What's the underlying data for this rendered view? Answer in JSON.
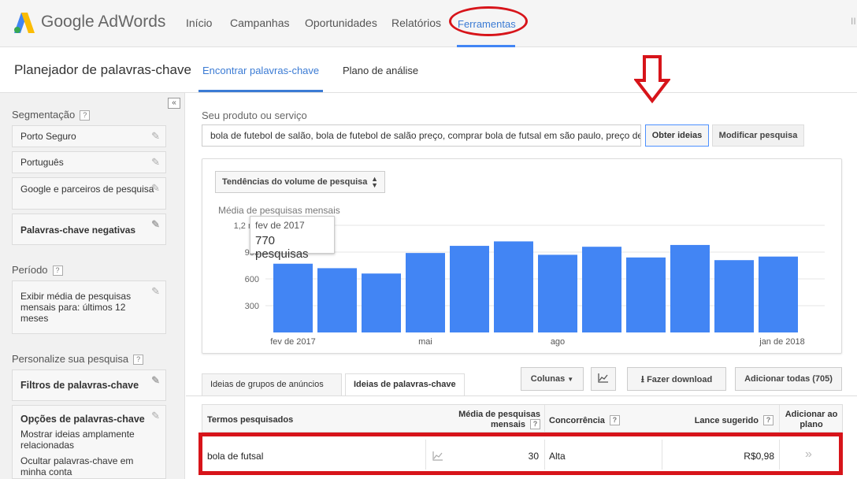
{
  "nav": {
    "logo_text": "Google AdWords",
    "items": [
      "Início",
      "Campanhas",
      "Oportunidades",
      "Relatórios",
      "Ferramentas"
    ],
    "active": "Ferramentas",
    "overflow": "II"
  },
  "subheader": {
    "title": "Planejador de palavras-chave",
    "tabs": [
      "Encontrar palavras-chave",
      "Plano de análise"
    ]
  },
  "sidebar": {
    "segmentation_title": "Segmentação",
    "help": "?",
    "segmentation_items": [
      "Porto Seguro",
      "Português",
      "Google e parceiros de pesquisa",
      "Palavras-chave negativas"
    ],
    "period_title": "Período",
    "period_item": "Exibir média de pesquisas mensais para: últimos 12 meses",
    "customize_title": "Personalize sua pesquisa",
    "filters": "Filtros de palavras-chave",
    "options_title": "Opções de palavras-chave",
    "options_line1": "Mostrar ideias amplamente relacionadas",
    "options_line2": "Ocultar palavras-chave em minha conta"
  },
  "search": {
    "label": "Seu produto ou serviço",
    "value": "bola de futebol de salão, bola de futebol de salão preço, comprar bola de futsal em são paulo, preço de",
    "get_ideas": "Obter ideias",
    "modify": "Modificar pesquisa"
  },
  "chart_panel": {
    "selector": "Tendências do volume de pesquisa",
    "tooltip_month": "fev de 2017",
    "tooltip_value": "770 pesquisas"
  },
  "chart_data": {
    "type": "bar",
    "title": "Média de pesquisas mensais",
    "yticks": [
      "300",
      "600",
      "900",
      "1,2 mil"
    ],
    "ylim": [
      0,
      1200
    ],
    "xtick_labels": [
      "fev de 2017",
      "mai",
      "ago",
      "jan de 2018"
    ],
    "values": [
      770,
      720,
      660,
      890,
      970,
      1020,
      870,
      960,
      840,
      980,
      810,
      850
    ],
    "bar_color": "#4285f4"
  },
  "toolbar": {
    "tab_groups": "Ideias de grupos de anúncios",
    "tab_keywords": "Ideias de palavras-chave",
    "columns": "Colunas",
    "download": "Fazer download",
    "add_all": "Adicionar todas (705)"
  },
  "table": {
    "headers": {
      "term": "Termos pesquisados",
      "avg1": "Média de pesquisas",
      "avg2": "mensais",
      "competition": "Concorrência",
      "bid": "Lance sugerido",
      "add1": "Adicionar ao",
      "add2": "plano"
    },
    "row": {
      "term": "bola de futsal",
      "avg": "30",
      "competition": "Alta",
      "bid": "R$0,98",
      "add": "»"
    }
  },
  "colors": {
    "accent": "#4285f4",
    "annotation": "#d7141a"
  }
}
